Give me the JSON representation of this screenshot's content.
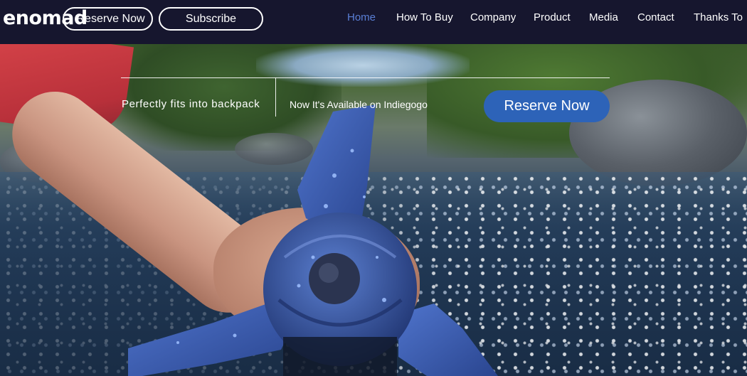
{
  "brand": {
    "logo_text": "enomad"
  },
  "header": {
    "reserve_label": "Reserve Now",
    "subscribe_label": "Subscribe"
  },
  "nav": {
    "items": [
      {
        "label": "Home",
        "active": true
      },
      {
        "label": "How To Buy",
        "active": false
      },
      {
        "label": "Company",
        "active": false
      },
      {
        "label": "Product",
        "active": false
      },
      {
        "label": "Media",
        "active": false
      },
      {
        "label": "Contact",
        "active": false
      },
      {
        "label": "Thanks To",
        "active": false
      }
    ]
  },
  "hero": {
    "image_subject": "hand-holding-turbine-in-river",
    "tagline": "Perfectly fits into backpack",
    "availability": "Now It's Available on Indiegogo",
    "reserve_label": "Reserve Now"
  },
  "colors": {
    "header_bg": "#16162e",
    "nav_active": "#5a7fd6",
    "accent_button": "#2d63b8",
    "turbine_blue": "#3a5bb0"
  }
}
